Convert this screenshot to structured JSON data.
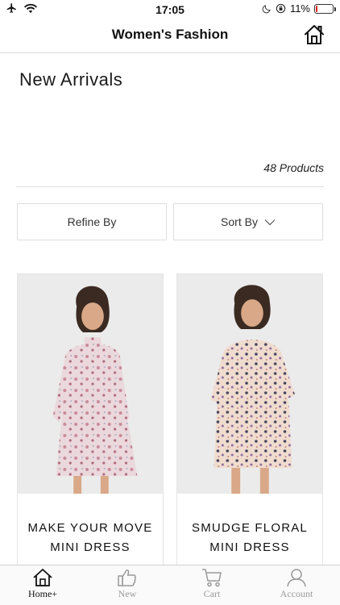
{
  "status_bar": {
    "time": "17:05",
    "battery_text": "11%",
    "battery_level": 0.11,
    "battery_color": "#e02020"
  },
  "nav": {
    "title": "Women's Fashion",
    "home_icon": "home-icon"
  },
  "page": {
    "heading": "New Arrivals",
    "product_count": "48  Products"
  },
  "controls": {
    "refine_label": "Refine By",
    "sort_label": "Sort By",
    "sort_icon": "chevron-down-icon"
  },
  "products": [
    {
      "line1": "MAKE YOUR MOVE",
      "line2": "MINI DRESS"
    },
    {
      "line1": "SMUDGE FLORAL",
      "line2": "MINI DRESS"
    }
  ],
  "tabs": [
    {
      "label": "Home+",
      "icon": "home-icon",
      "active": true
    },
    {
      "label": "New",
      "icon": "thumbs-up-icon",
      "active": false
    },
    {
      "label": "Cart",
      "icon": "cart-icon",
      "active": false
    },
    {
      "label": "Account",
      "icon": "person-icon",
      "active": false
    }
  ]
}
